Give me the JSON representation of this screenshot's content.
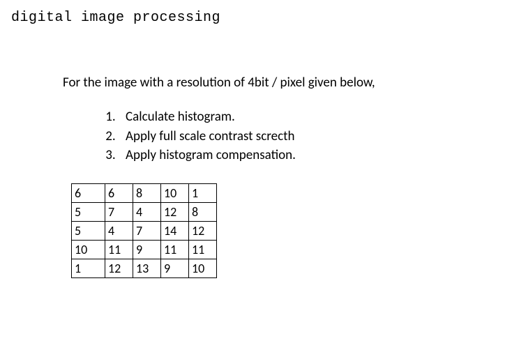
{
  "title": "digital image processing",
  "intro": "For the image with a resolution of 4bit / pixel given below,",
  "tasks": [
    "Calculate histogram.",
    "Apply full scale contrast screcth",
    "Apply histogram compensation."
  ],
  "grid": [
    [
      "6",
      "6",
      "8",
      "10",
      "1"
    ],
    [
      "5",
      "7",
      "4",
      "12",
      "8"
    ],
    [
      "5",
      "4",
      "7",
      "14",
      "12"
    ],
    [
      "10",
      "11",
      "9",
      "11",
      "11"
    ],
    [
      "1",
      "12",
      "13",
      "9",
      "10"
    ]
  ]
}
